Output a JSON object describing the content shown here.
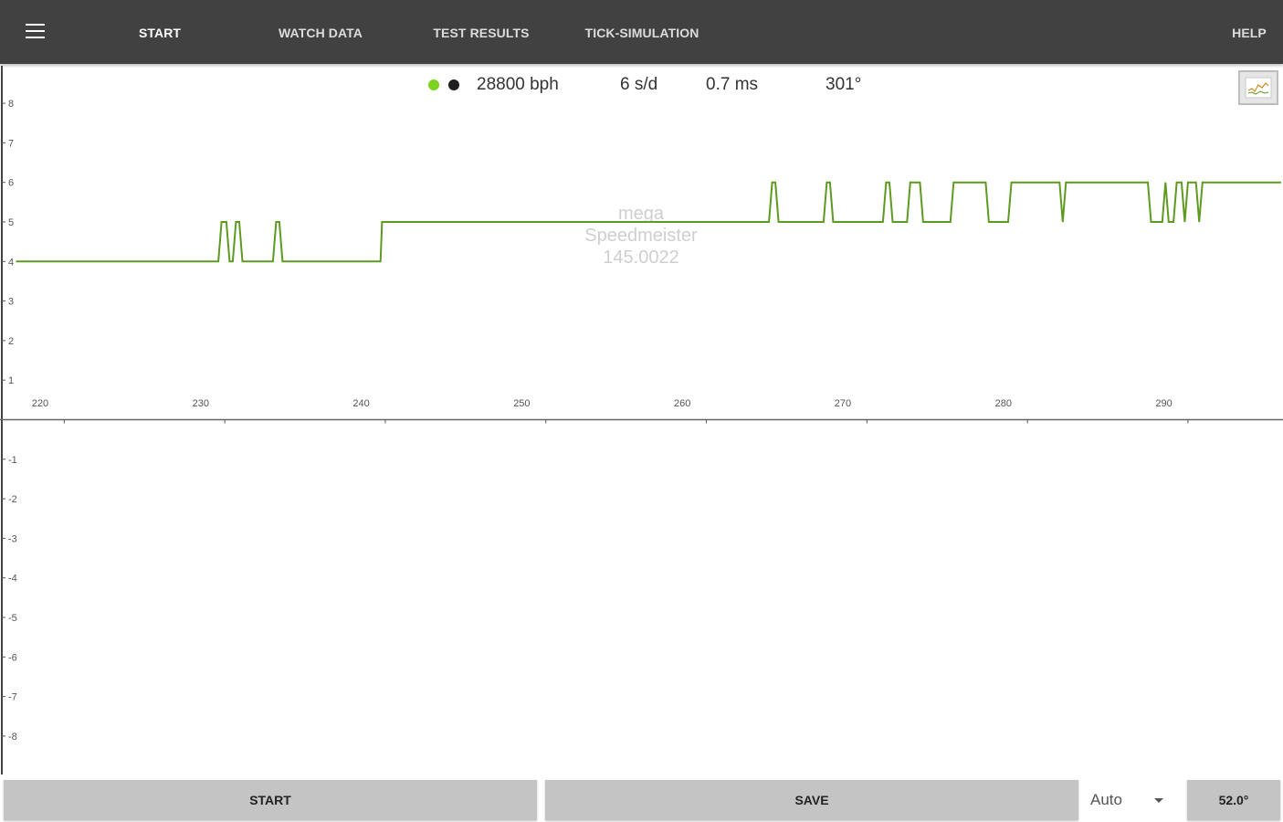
{
  "nav": {
    "tabs": [
      {
        "label": "START",
        "active": true
      },
      {
        "label": "WATCH DATA",
        "active": false
      },
      {
        "label": "TEST RESULTS",
        "active": false
      },
      {
        "label": "TICK-SIMULATION",
        "active": false
      }
    ],
    "help": "HELP",
    "menu_icon": "hamburger-menu-icon"
  },
  "status": {
    "indicator_colors": [
      "#7ed321",
      "#1f1f1f"
    ],
    "beat_rate": "28800 bph",
    "rate": "6 s/d",
    "beat_error": "0.7 ms",
    "amplitude": "301°"
  },
  "watermark": {
    "line1": "mega",
    "line2": "Speedmeister",
    "line3": "145.0022"
  },
  "chart_data": {
    "type": "line",
    "line_color": "#5d9b20",
    "x_ticks": [
      220,
      230,
      240,
      250,
      260,
      270,
      280,
      290
    ],
    "y_ticks": [
      8,
      7,
      6,
      5,
      4,
      3,
      2,
      1,
      -1,
      -2,
      -3,
      -4,
      -5,
      -6,
      -7,
      -8
    ],
    "y_tick_labels": [
      "8",
      "7",
      "6",
      "5",
      "4",
      "3",
      "2",
      "1",
      "-1",
      "-2",
      "-3",
      "-4",
      "-5",
      "-6",
      "-7",
      "-8"
    ],
    "xlim": [
      218.5,
      297.5
    ],
    "ylim": [
      -9,
      9
    ],
    "series": [
      {
        "points": [
          [
            218.5,
            4
          ],
          [
            231.1,
            4
          ],
          [
            231.3,
            5
          ],
          [
            231.6,
            5
          ],
          [
            231.8,
            4
          ],
          [
            232.0,
            4
          ],
          [
            232.2,
            5
          ],
          [
            232.4,
            5
          ],
          [
            232.6,
            4
          ],
          [
            234.5,
            4
          ],
          [
            234.7,
            5
          ],
          [
            234.9,
            5
          ],
          [
            235.1,
            4
          ],
          [
            241.2,
            4
          ],
          [
            241.3,
            5
          ],
          [
            265.4,
            5
          ],
          [
            265.6,
            6
          ],
          [
            265.8,
            6
          ],
          [
            266.0,
            5
          ],
          [
            268.8,
            5
          ],
          [
            269.0,
            6
          ],
          [
            269.2,
            6
          ],
          [
            269.4,
            5
          ],
          [
            272.5,
            5
          ],
          [
            272.7,
            6
          ],
          [
            272.9,
            6
          ],
          [
            273.1,
            5
          ],
          [
            274.0,
            5
          ],
          [
            274.2,
            6
          ],
          [
            274.8,
            6
          ],
          [
            275.0,
            5
          ],
          [
            276.7,
            5
          ],
          [
            276.9,
            6
          ],
          [
            278.9,
            6
          ],
          [
            279.1,
            5
          ],
          [
            280.3,
            5
          ],
          [
            280.5,
            6
          ],
          [
            283.5,
            6
          ],
          [
            283.7,
            5
          ],
          [
            283.9,
            6
          ],
          [
            289.0,
            6
          ],
          [
            289.2,
            5
          ],
          [
            289.9,
            5
          ],
          [
            290.1,
            6
          ],
          [
            290.3,
            5
          ],
          [
            290.6,
            5
          ],
          [
            290.8,
            6
          ],
          [
            291.1,
            6
          ],
          [
            291.3,
            5
          ],
          [
            291.5,
            6
          ],
          [
            292.0,
            6
          ],
          [
            292.2,
            5
          ],
          [
            292.4,
            6
          ],
          [
            297.3,
            6
          ]
        ]
      }
    ],
    "grid": false
  },
  "controls": {
    "start_label": "START",
    "save_label": "SAVE",
    "mode_value": "Auto",
    "lift_angle": "52.0°"
  }
}
